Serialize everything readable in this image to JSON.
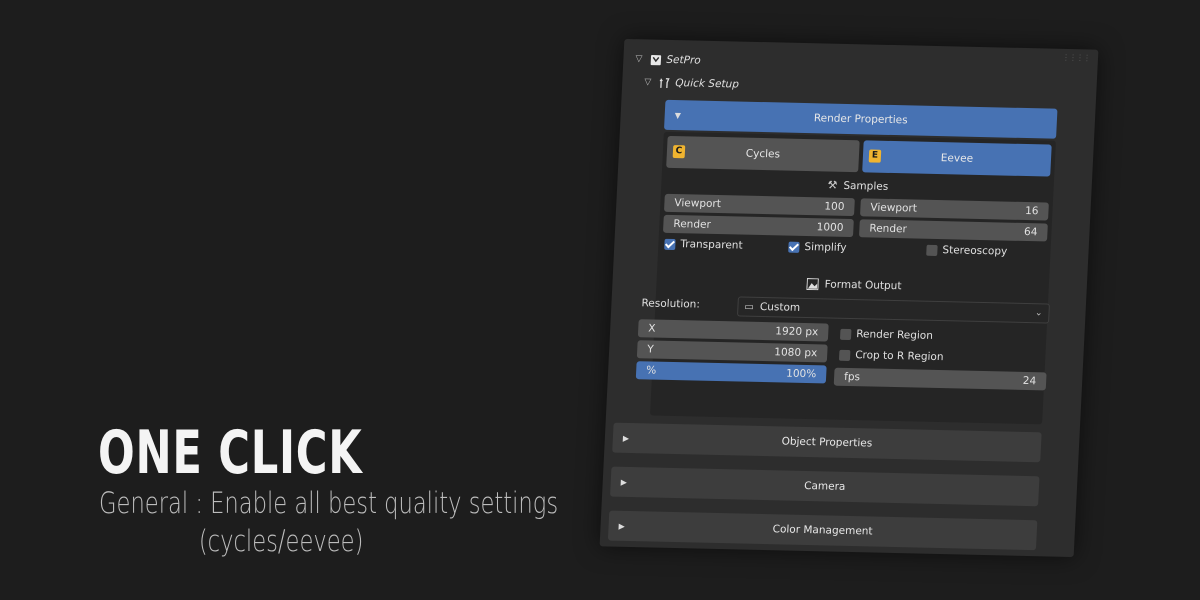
{
  "promo": {
    "title": "ONE CLICK",
    "subtitle_line1": "General : Enable all best quality settings",
    "subtitle_line2": "(cycles/eevee)"
  },
  "panel": {
    "addon_name": "SetPro",
    "subpanel_name": "Quick Setup",
    "render_properties": {
      "label": "Render Properties",
      "engines": {
        "cycles": "Cycles",
        "eevee": "Eevee",
        "active": "Eevee"
      },
      "samples": {
        "label": "Samples",
        "cycles": {
          "viewport_label": "Viewport",
          "viewport_value": "100",
          "render_label": "Render",
          "render_value": "1000"
        },
        "eevee": {
          "viewport_label": "Viewport",
          "viewport_value": "16",
          "render_label": "Render",
          "render_value": "64"
        }
      },
      "checks": {
        "transparent": {
          "label": "Transparent",
          "checked": true
        },
        "simplify": {
          "label": "Simplify",
          "checked": true
        },
        "stereoscopy": {
          "label": "Stereoscopy",
          "checked": false
        }
      },
      "format_output": {
        "label": "Format Output",
        "resolution_label": "Resolution:",
        "resolution_preset": "Custom",
        "x_label": "X",
        "x_value": "1920 px",
        "y_label": "Y",
        "y_value": "1080 px",
        "pct_label": "%",
        "pct_value": "100%",
        "render_region": {
          "label": "Render Region",
          "checked": false
        },
        "crop_region": {
          "label": "Crop to R Region",
          "checked": false
        },
        "fps_label": "fps",
        "fps_value": "24"
      }
    },
    "collapsed_panels": [
      "Object  Properties",
      "Camera",
      "Color Management"
    ]
  },
  "colors": {
    "accent": "#4772b3",
    "panel_bg": "#2d2d2d",
    "page_bg": "#1d1d1d",
    "engine_icon": "#f0b430"
  },
  "icons": [
    "chevron-down-icon",
    "setpro-icon",
    "tools-icon",
    "triangle-down-icon",
    "triangle-right-icon",
    "cycles-engine-icon",
    "eevee-engine-icon",
    "samples-icon",
    "format-output-icon",
    "monitor-icon",
    "dropdown-chevron-icon",
    "grip-icon"
  ]
}
